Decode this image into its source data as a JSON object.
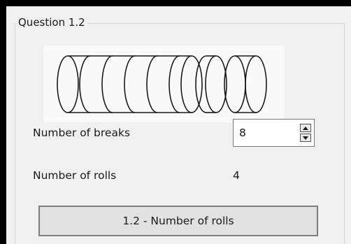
{
  "group": {
    "title": "Question 1.2"
  },
  "figure": {
    "icon": "roll-cylinders-icon",
    "segments_before_gap": 7,
    "segments_after_gap": 1
  },
  "breaks": {
    "label": "Number of breaks",
    "value": "8"
  },
  "rolls": {
    "label": "Number of rolls",
    "value": "4"
  },
  "action": {
    "label": "1.2 - Number of rolls"
  },
  "colors": {
    "background": "#f0f0f0",
    "button": "#e1e1e1",
    "border": "#7d7d7d"
  }
}
